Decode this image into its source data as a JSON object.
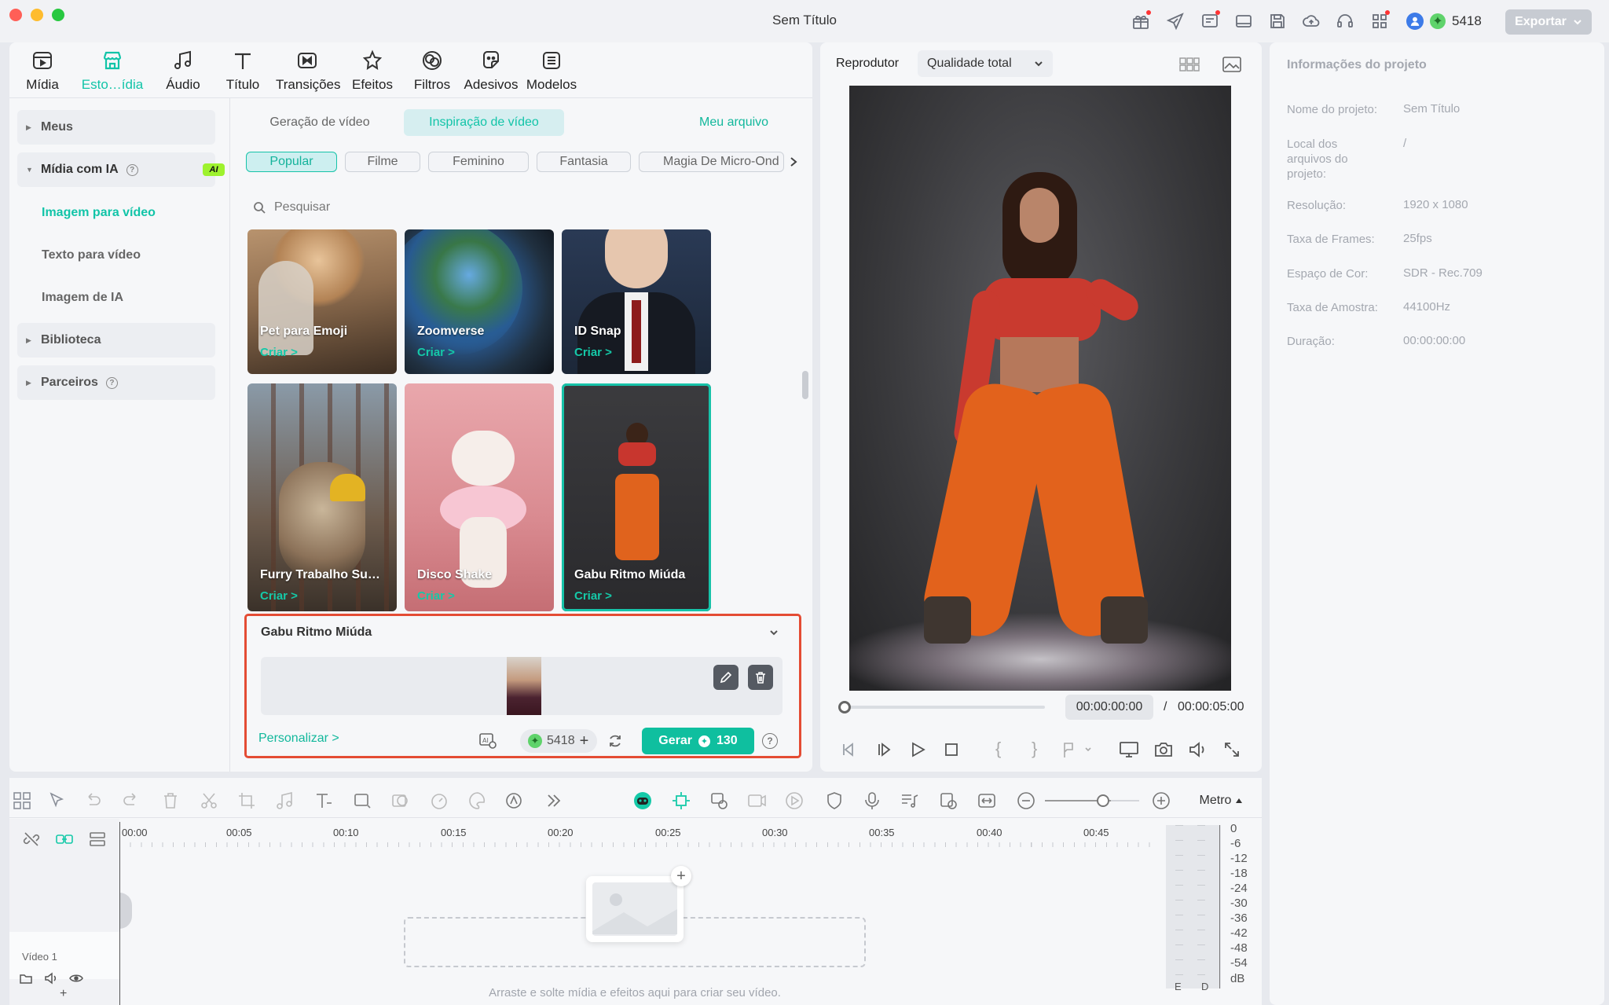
{
  "window": {
    "title": "Sem Título",
    "credits": "5418",
    "export_label": "Exportar"
  },
  "top_tabs": [
    {
      "label": "Mídia",
      "icon": "media-icon"
    },
    {
      "label": "Esto…ídia",
      "icon": "store-icon",
      "active": true
    },
    {
      "label": "Áudio",
      "icon": "music-note-icon"
    },
    {
      "label": "Título",
      "icon": "title-t-icon"
    },
    {
      "label": "Transições",
      "icon": "transition-icon"
    },
    {
      "label": "Efeitos",
      "icon": "effects-icon"
    },
    {
      "label": "Filtros",
      "icon": "filter-icon"
    },
    {
      "label": "Adesivos",
      "icon": "sticker-icon"
    },
    {
      "label": "Modelos",
      "icon": "template-icon"
    }
  ],
  "sidebar": {
    "meus": "Meus",
    "midia_ia": "Mídia com IA",
    "ai_badge": "AI",
    "sub_items": [
      "Imagem para vídeo",
      "Texto para vídeo",
      "Imagem de IA"
    ],
    "biblioteca": "Biblioteca",
    "parceiros": "Parceiros"
  },
  "content": {
    "sub_tabs": [
      "Geração de vídeo",
      "Inspiração de vídeo"
    ],
    "my_file": "Meu arquivo",
    "chips": [
      "Popular",
      "Filme",
      "Feminino",
      "Fantasia",
      "Magia De Micro-Ond"
    ],
    "search_placeholder": "Pesquisar",
    "cards": [
      {
        "name": "Pet para Emoji",
        "cta": "Criar >"
      },
      {
        "name": "Zoomverse",
        "cta": "Criar >"
      },
      {
        "name": "ID Snap",
        "cta": "Criar >"
      },
      {
        "name": "Furry Trabalho Su…",
        "cta": "Criar >"
      },
      {
        "name": "Disco Shake",
        "cta": "Criar >"
      },
      {
        "name": "Gabu Ritmo Miúda",
        "cta": "Criar >"
      }
    ]
  },
  "detail": {
    "title": "Gabu Ritmo Miúda",
    "customize": "Personalizar >",
    "credits": "5418",
    "generate_label": "Gerar",
    "generate_cost": "130"
  },
  "player": {
    "label": "Reprodutor",
    "quality": "Qualidade total",
    "current_time": "00:00:00:00",
    "separator": "/",
    "total_time": "00:00:05:00"
  },
  "info": {
    "title": "Informações do projeto",
    "rows": [
      {
        "label": "Nome do projeto:",
        "value": "Sem Título"
      },
      {
        "label": "Local dos arquivos do projeto:",
        "value": "/"
      },
      {
        "label": "Resolução:",
        "value": "1920 x 1080"
      },
      {
        "label": "Taxa de Frames:",
        "value": "25fps"
      },
      {
        "label": "Espaço de Cor:",
        "value": "SDR - Rec.709"
      },
      {
        "label": "Taxa de Amostra:",
        "value": "44100Hz"
      },
      {
        "label": "Duração:",
        "value": "00:00:00:00"
      }
    ]
  },
  "timeline": {
    "meter_label": "Metro",
    "ruler": [
      "00:00",
      "00:05",
      "00:10",
      "00:15",
      "00:20",
      "00:25",
      "00:30",
      "00:35",
      "00:40",
      "00:45"
    ],
    "track_name": "Vídeo 1",
    "drop_hint": "Arraste e solte mídia e efeitos aqui para criar seu vídeo.",
    "db_scale": [
      "0",
      "-6",
      "-12",
      "-18",
      "-24",
      "-30",
      "-36",
      "-42",
      "-48",
      "-54",
      "dB"
    ],
    "channels": [
      "E",
      "D"
    ]
  },
  "colors": {
    "accent": "#12c4a8",
    "highlight_border": "#e44c34",
    "generate_button": "#0fbf9f"
  }
}
